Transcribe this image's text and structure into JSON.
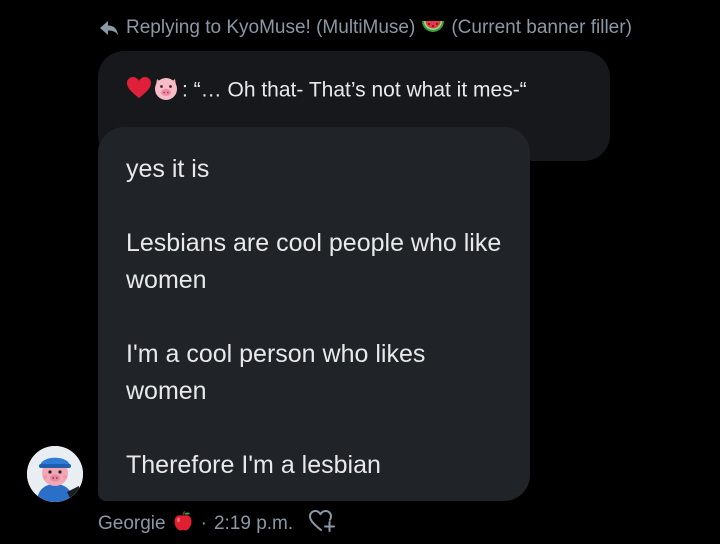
{
  "reply_context": {
    "text_prefix": "Replying to KyoMuse! (MultiMuse)",
    "text_suffix": "(Current banner filler)",
    "icons": [
      "reply-arrow-icon",
      "watermelon-icon"
    ]
  },
  "quoted_message": {
    "text": ": “… Oh that- That’s not what it mes-“",
    "icons": [
      "red-heart-icon",
      "pig-face-icon"
    ]
  },
  "message": {
    "paragraphs": [
      "yes it is",
      "Lesbians are cool people who like women",
      "I'm a cool person who likes women",
      "Therefore I'm a lesbian"
    ]
  },
  "meta": {
    "sender": "Georgie",
    "separator": "·",
    "time": "2:19 p.m.",
    "icons": [
      "apple-icon",
      "add-reaction-icon"
    ]
  },
  "colors": {
    "background": "#000000",
    "quoted_bubble": "#16181c",
    "message_bubble": "#202327",
    "primary_text": "#e7e9ea",
    "secondary_text": "#8b98a5"
  }
}
